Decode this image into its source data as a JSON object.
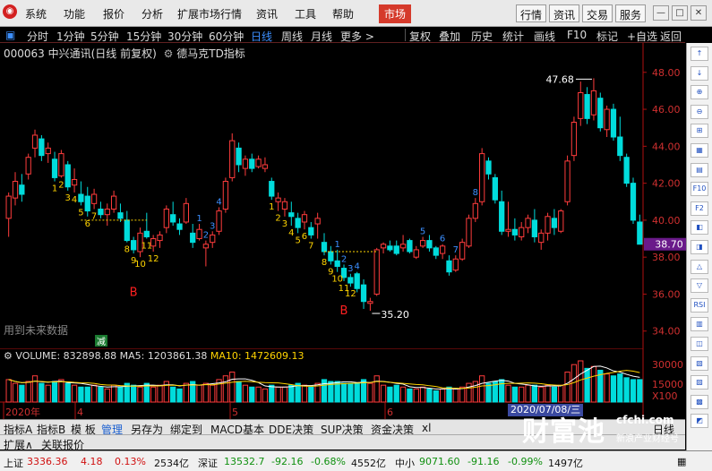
{
  "menubar": {
    "items": [
      "系统",
      "功能",
      "报价",
      "分析",
      "扩展市场行情",
      "资讯",
      "工具",
      "帮助"
    ],
    "market": "市场",
    "right_buttons": [
      "行情",
      "资讯",
      "交易",
      "服务"
    ],
    "window_buttons": [
      "—",
      "□",
      "✕"
    ]
  },
  "toolbar": {
    "periods": [
      "分时",
      "1分钟",
      "5分钟",
      "15分钟",
      "30分钟",
      "60分钟",
      "日线",
      "周线",
      "月线",
      "更多 >"
    ],
    "active_period": "日线",
    "actions": [
      "复权",
      "叠加",
      "历史",
      "统计",
      "画线",
      "F10",
      "标记",
      "+自选",
      "返回"
    ]
  },
  "chart_header": {
    "stock": "000063 中兴通讯(日线 前复权)",
    "indicator": "德马克TD指标"
  },
  "volume_header": {
    "volume": "VOLUME: 832898.88",
    "ma5": "MA5: 1203861.38",
    "ma10": "MA10: 1472609.13"
  },
  "side_buttons": [
    "↑",
    "↓",
    "⊕",
    "⊖",
    "⊞",
    "▦",
    "▤",
    "F10",
    "F2",
    "◧",
    "◨",
    "△",
    "▽",
    "RSI",
    "▥",
    "◫",
    "▧",
    "▨",
    "▩",
    "◩"
  ],
  "bottom_tabs": [
    "指标A",
    "指标B",
    "模 板",
    "管理",
    "另存为",
    "绑定到",
    "MACD基本",
    "DDE决策",
    "SUP决策",
    "资金决策",
    "xl"
  ],
  "active_tab": "管理",
  "expand_row": [
    "扩展∧",
    "关联报价"
  ],
  "status": {
    "sh_label": "上证",
    "sh_value": "3336.36",
    "sh_change": "4.18",
    "sh_pct": "0.13%",
    "sh_amount": "2534亿",
    "sz_label": "深证",
    "sz_value": "13532.7",
    "sz_change": "-92.16",
    "sz_pct": "-0.68%",
    "sz_amount": "4552亿",
    "zx_label": "中小",
    "zx_value": "9071.60",
    "zx_change": "-91.16",
    "zx_pct": "-0.99%",
    "zx_amount": "1497亿"
  },
  "date_box": "2020/07/08/三",
  "watermark": {
    "big": "财富池",
    "url": "cfchi.com",
    "sub": "新浪产业财经号"
  },
  "colors": {
    "up": "#ff3c3c",
    "down": "#00dcdc",
    "axis": "#b01010",
    "ma5": "#ffffff",
    "ma10": "#ffd400",
    "td_yellow": "#ffd400",
    "td_blue": "#3c8fff"
  },
  "chart_data": {
    "type": "candlestick",
    "y_range": [
      33.6,
      49.2
    ],
    "y_ticks": [
      "48.00",
      "46.00",
      "44.00",
      "42.00",
      "40.00",
      "38.00",
      "36.00",
      "34.00"
    ],
    "current_price": "38.70",
    "x_labels": [
      "2020年",
      "4",
      "5",
      "6"
    ],
    "max_label": "47.68",
    "min_label": "35.20",
    "future_label": "用到未来数据",
    "minus_tag": "减",
    "buy_signals": [
      "B",
      "B"
    ],
    "candles": [
      [
        40.1,
        41.5,
        39.1,
        41.3
      ],
      [
        41.2,
        42.6,
        40.8,
        42.1
      ],
      [
        41.9,
        42.5,
        41.0,
        41.4
      ],
      [
        42.5,
        43.6,
        42.2,
        43.4
      ],
      [
        43.9,
        44.9,
        43.4,
        44.6
      ],
      [
        44.4,
        44.6,
        43.2,
        43.5
      ],
      [
        43.6,
        44.2,
        43.1,
        43.9
      ],
      [
        43.3,
        43.7,
        42.1,
        42.3
      ],
      [
        42.4,
        43.8,
        42.3,
        43.6
      ],
      [
        43.0,
        43.2,
        41.6,
        41.8
      ],
      [
        41.9,
        42.8,
        41.5,
        42.2
      ],
      [
        41.4,
        42.1,
        40.8,
        41.0
      ],
      [
        41.3,
        41.8,
        40.2,
        40.5
      ],
      [
        40.9,
        41.7,
        40.6,
        41.4
      ],
      [
        40.6,
        41.0,
        40.1,
        40.3
      ],
      [
        40.3,
        40.9,
        39.7,
        40.6
      ],
      [
        40.6,
        41.6,
        40.4,
        41.3
      ],
      [
        40.4,
        40.9,
        39.9,
        40.1
      ],
      [
        40.0,
        40.5,
        38.8,
        38.9
      ],
      [
        38.9,
        39.1,
        38.2,
        38.4
      ],
      [
        38.3,
        39.6,
        38.0,
        39.3
      ],
      [
        39.4,
        40.4,
        39.0,
        39.1
      ],
      [
        38.6,
        39.2,
        38.3,
        39.0
      ],
      [
        38.9,
        39.4,
        38.5,
        39.2
      ],
      [
        39.6,
        40.8,
        39.3,
        40.6
      ],
      [
        40.3,
        41.0,
        39.7,
        39.9
      ],
      [
        39.8,
        40.1,
        39.2,
        39.5
      ],
      [
        39.9,
        41.2,
        39.8,
        40.9
      ],
      [
        39.3,
        39.8,
        38.5,
        38.8
      ],
      [
        39.0,
        39.8,
        38.9,
        39.5
      ],
      [
        38.5,
        38.9,
        37.5,
        38.7
      ],
      [
        38.8,
        39.4,
        38.5,
        39.2
      ],
      [
        39.4,
        40.7,
        39.2,
        40.5
      ],
      [
        40.6,
        42.3,
        40.4,
        42.1
      ],
      [
        42.3,
        44.7,
        42.1,
        44.3
      ],
      [
        43.9,
        44.2,
        42.6,
        43.0
      ],
      [
        42.8,
        43.5,
        42.4,
        43.3
      ],
      [
        43.3,
        43.6,
        42.6,
        42.8
      ],
      [
        42.9,
        43.5,
        42.8,
        43.3
      ],
      [
        42.8,
        43.4,
        42.6,
        43.0
      ],
      [
        42.1,
        42.3,
        41.1,
        41.3
      ],
      [
        41.0,
        41.5,
        40.5,
        41.2
      ],
      [
        40.6,
        41.2,
        40.2,
        41.0
      ],
      [
        40.4,
        41.0,
        39.7,
        40.2
      ],
      [
        40.1,
        40.4,
        39.3,
        39.6
      ],
      [
        39.9,
        40.5,
        39.5,
        40.3
      ],
      [
        39.6,
        39.9,
        39.0,
        39.2
      ],
      [
        39.8,
        40.4,
        39.0,
        40.1
      ],
      [
        38.8,
        39.3,
        38.1,
        38.3
      ],
      [
        38.3,
        38.6,
        37.6,
        37.8
      ],
      [
        37.8,
        38.4,
        37.2,
        37.5
      ],
      [
        37.4,
        37.6,
        36.7,
        36.9
      ],
      [
        36.9,
        37.1,
        36.4,
        36.6
      ],
      [
        37.1,
        37.2,
        36.1,
        36.3
      ],
      [
        36.5,
        36.8,
        35.2,
        35.6
      ],
      [
        35.5,
        35.8,
        35.1,
        35.6
      ],
      [
        36.0,
        38.5,
        35.9,
        38.4
      ],
      [
        38.5,
        38.8,
        38.2,
        38.7
      ],
      [
        38.6,
        38.9,
        38.3,
        38.4
      ],
      [
        38.6,
        38.9,
        38.1,
        38.2
      ],
      [
        38.5,
        39.2,
        38.3,
        38.7
      ],
      [
        38.9,
        39.0,
        38.2,
        38.3
      ],
      [
        38.0,
        38.6,
        37.9,
        38.4
      ],
      [
        38.6,
        39.1,
        38.5,
        38.9
      ],
      [
        38.9,
        39.2,
        38.3,
        38.5
      ],
      [
        38.5,
        38.6,
        37.9,
        38.1
      ],
      [
        38.2,
        38.7,
        37.9,
        38.6
      ],
      [
        37.8,
        38.1,
        37.0,
        37.2
      ],
      [
        37.3,
        38.1,
        37.2,
        37.9
      ],
      [
        37.9,
        39.0,
        37.8,
        38.8
      ],
      [
        38.6,
        40.3,
        38.5,
        40.1
      ],
      [
        40.1,
        41.2,
        39.9,
        40.9
      ],
      [
        41.0,
        43.9,
        40.8,
        43.6
      ],
      [
        43.2,
        43.4,
        42.2,
        42.5
      ],
      [
        42.3,
        42.5,
        40.9,
        41.1
      ],
      [
        41.0,
        41.6,
        39.2,
        39.4
      ],
      [
        39.4,
        41.0,
        39.1,
        39.5
      ],
      [
        39.5,
        40.1,
        38.9,
        39.2
      ],
      [
        39.1,
        39.9,
        38.9,
        39.6
      ],
      [
        39.6,
        40.3,
        39.3,
        40.1
      ],
      [
        40.0,
        40.6,
        38.8,
        39.1
      ],
      [
        38.8,
        39.5,
        38.4,
        39.3
      ],
      [
        39.3,
        40.4,
        38.9,
        40.2
      ],
      [
        40.1,
        40.6,
        39.2,
        39.6
      ],
      [
        39.4,
        40.6,
        39.3,
        40.5
      ],
      [
        41.0,
        43.5,
        40.8,
        43.2
      ],
      [
        43.5,
        45.6,
        43.2,
        45.3
      ],
      [
        45.5,
        47.5,
        45.1,
        46.9
      ],
      [
        46.8,
        47.2,
        45.2,
        45.5
      ],
      [
        45.7,
        47.68,
        45.4,
        47.0
      ],
      [
        46.6,
        46.9,
        44.8,
        45.0
      ],
      [
        44.9,
        46.2,
        44.5,
        46.0
      ],
      [
        46.0,
        46.3,
        44.3,
        44.5
      ],
      [
        44.5,
        45.6,
        43.2,
        43.5
      ],
      [
        43.4,
        43.6,
        41.8,
        42.0
      ],
      [
        42.0,
        42.3,
        39.8,
        40.0
      ],
      [
        39.9,
        40.3,
        38.7,
        38.7
      ]
    ],
    "td_labels": [
      {
        "i": 7,
        "t": "1",
        "c": "y"
      },
      {
        "i": 8,
        "t": "2",
        "c": "y"
      },
      {
        "i": 9,
        "t": "3",
        "c": "y"
      },
      {
        "i": 10,
        "t": "4",
        "c": "y"
      },
      {
        "i": 11,
        "t": "5",
        "c": "y"
      },
      {
        "i": 12,
        "t": "6",
        "c": "y"
      },
      {
        "i": 13,
        "t": "7",
        "c": "y"
      },
      {
        "i": 18,
        "t": "8",
        "c": "y"
      },
      {
        "i": 19,
        "t": "9",
        "c": "y"
      },
      {
        "i": 20,
        "t": "10",
        "c": "y"
      },
      {
        "i": 21,
        "t": "11",
        "c": "y"
      },
      {
        "i": 22,
        "t": "12",
        "c": "y"
      },
      {
        "i": 29,
        "t": "1",
        "c": "b"
      },
      {
        "i": 30,
        "t": "2",
        "c": "b"
      },
      {
        "i": 31,
        "t": "3",
        "c": "b"
      },
      {
        "i": 32,
        "t": "4",
        "c": "b"
      },
      {
        "i": 40,
        "t": "1",
        "c": "y"
      },
      {
        "i": 41,
        "t": "2",
        "c": "y"
      },
      {
        "i": 42,
        "t": "3",
        "c": "y"
      },
      {
        "i": 43,
        "t": "4",
        "c": "y"
      },
      {
        "i": 44,
        "t": "5",
        "c": "y"
      },
      {
        "i": 45,
        "t": "6",
        "c": "y"
      },
      {
        "i": 46,
        "t": "7",
        "c": "y"
      },
      {
        "i": 48,
        "t": "8",
        "c": "y"
      },
      {
        "i": 49,
        "t": "9",
        "c": "y"
      },
      {
        "i": 50,
        "t": "10",
        "c": "y"
      },
      {
        "i": 51,
        "t": "11",
        "c": "y"
      },
      {
        "i": 52,
        "t": "12",
        "c": "y"
      },
      {
        "i": 50,
        "t": "1",
        "c": "b"
      },
      {
        "i": 51,
        "t": "2",
        "c": "b"
      },
      {
        "i": 52,
        "t": "3",
        "c": "b"
      },
      {
        "i": 53,
        "t": "4",
        "c": "b"
      },
      {
        "i": 63,
        "t": "5",
        "c": "b"
      },
      {
        "i": 66,
        "t": "6",
        "c": "b"
      },
      {
        "i": 68,
        "t": "7",
        "c": "b"
      },
      {
        "i": 71,
        "t": "8",
        "c": "b"
      }
    ],
    "vol_axis": [
      "30000",
      "15000",
      "X100"
    ],
    "volumes": [
      12,
      10,
      9,
      11,
      14,
      10,
      9,
      11,
      12,
      10,
      9,
      8,
      8,
      9,
      8,
      7,
      9,
      8,
      10,
      9,
      8,
      10,
      8,
      9,
      11,
      8,
      7,
      10,
      11,
      9,
      10,
      9,
      12,
      14,
      16,
      11,
      9,
      8,
      8,
      7,
      9,
      8,
      8,
      9,
      10,
      9,
      8,
      10,
      12,
      11,
      11,
      10,
      10,
      10,
      12,
      10,
      14,
      9,
      8,
      9,
      8,
      7,
      7,
      8,
      7,
      6,
      7,
      8,
      7,
      8,
      10,
      11,
      14,
      10,
      11,
      12,
      9,
      8,
      8,
      9,
      9,
      8,
      9,
      8,
      9,
      16,
      20,
      22,
      18,
      19,
      17,
      15,
      14,
      15,
      13,
      12,
      12
    ]
  }
}
